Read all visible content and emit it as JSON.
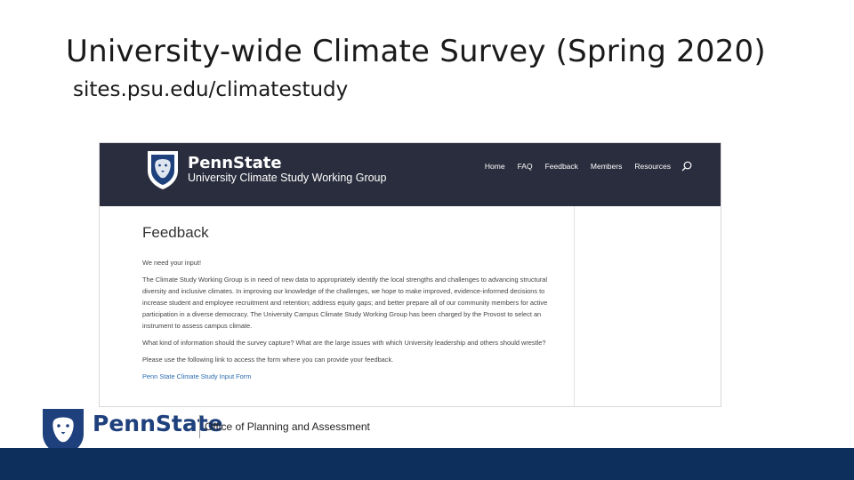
{
  "slide": {
    "title": "University-wide Climate Survey (Spring 2020)",
    "subtitle": "sites.psu.edu/climatestudy"
  },
  "site": {
    "brand": "PennState",
    "group": "University Climate Study Working Group",
    "nav": [
      "Home",
      "FAQ",
      "Feedback",
      "Members",
      "Resources"
    ],
    "page_heading": "Feedback",
    "paragraphs": [
      "We need your input!",
      "The Climate Study Working Group is in need of new data to appropriately identify the local strengths and challenges to advancing structural diversity and inclusive climates. In improving our knowledge of the challenges, we hope to make improved, evidence-informed decisions to increase student and employee recruitment and retention; address equity gaps; and better prepare all of our community members for active participation in a diverse democracy. The University Campus Climate Study Working Group has been charged by the Provost to select an instrument to assess campus climate.",
      "What kind of information should the survey capture? What are the large issues with which University leadership and others should wrestle?",
      "Please use the following link to access the form where you can provide your feedback."
    ],
    "link_text": "Penn State Climate Study Input Form"
  },
  "footer": {
    "brand": "PennState",
    "office": "Office of Planning and Assessment"
  },
  "colors": {
    "header_bg": "#2a2d3d",
    "brand_blue": "#1e407c",
    "bottom_bar": "#0c2f5c",
    "link": "#2b6cb0"
  },
  "icons": [
    "nittany-lion-shield-icon",
    "search-icon"
  ]
}
